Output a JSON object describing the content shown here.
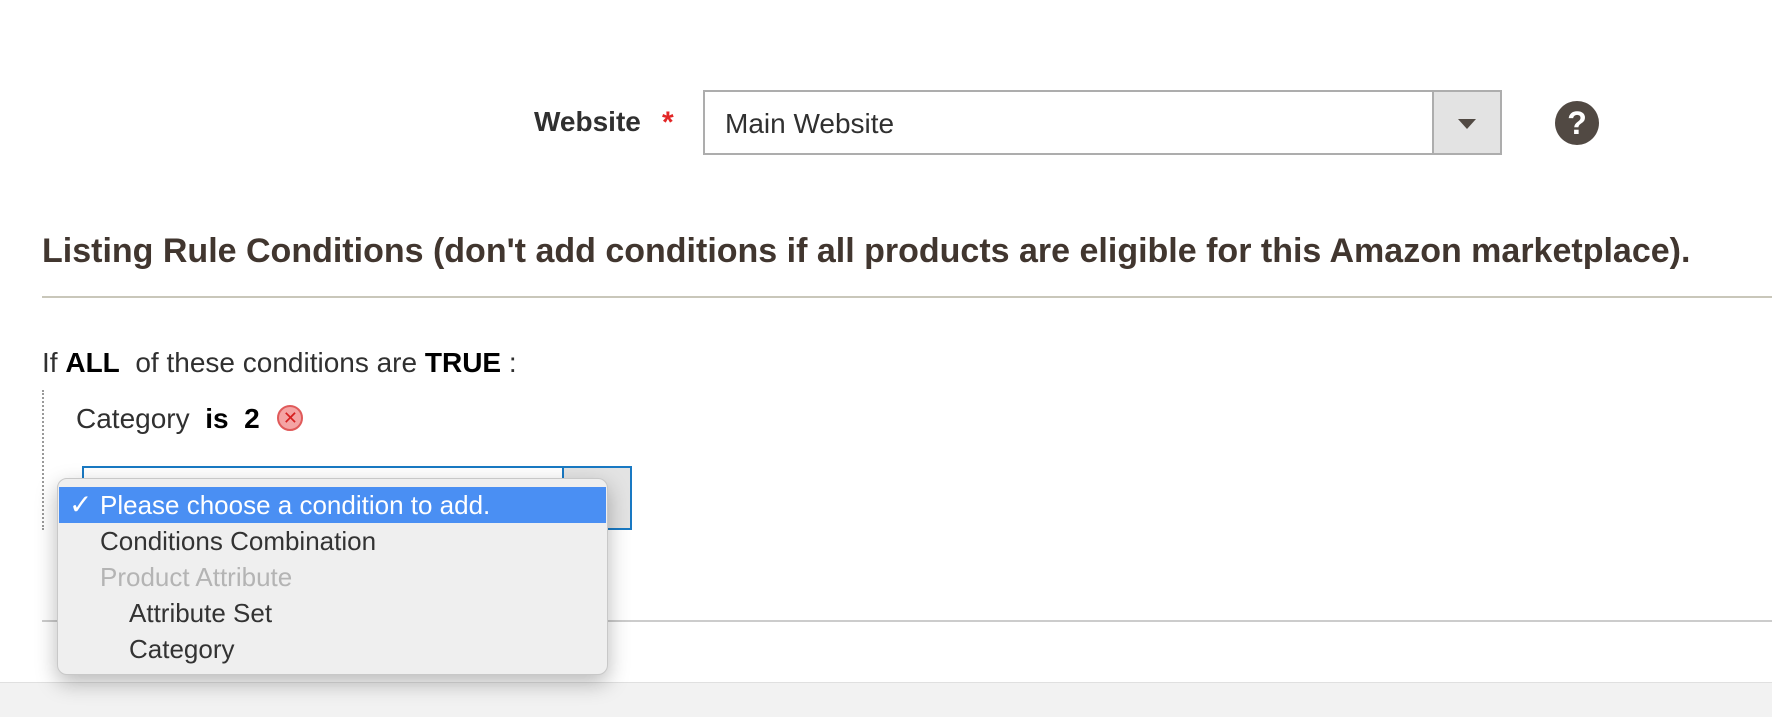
{
  "website_field": {
    "label": "Website",
    "required_marker": "*",
    "value": "Main Website",
    "help_icon": "?"
  },
  "section": {
    "title": "Listing Rule Conditions (don't add conditions if all products are eligible for this Amazon marketplace)."
  },
  "conditions": {
    "intro_prefix": "If",
    "aggregator": "ALL",
    "intro_middle": "of these conditions are",
    "value": "TRUE",
    "intro_suffix": ":",
    "items": [
      {
        "attribute": "Category",
        "operator": "is",
        "value": "2"
      }
    ]
  },
  "add_condition_dropdown": {
    "options": [
      {
        "label": "Please choose a condition to add.",
        "selected": true
      },
      {
        "label": "Conditions Combination"
      },
      {
        "label": "Product Attribute",
        "group_header": true
      },
      {
        "label": "Attribute Set",
        "indent": true
      },
      {
        "label": "Category",
        "indent": true
      }
    ]
  },
  "colors": {
    "required": "#e22626",
    "selected_option": "#4a8ff3",
    "focus_border": "#1979c3"
  }
}
